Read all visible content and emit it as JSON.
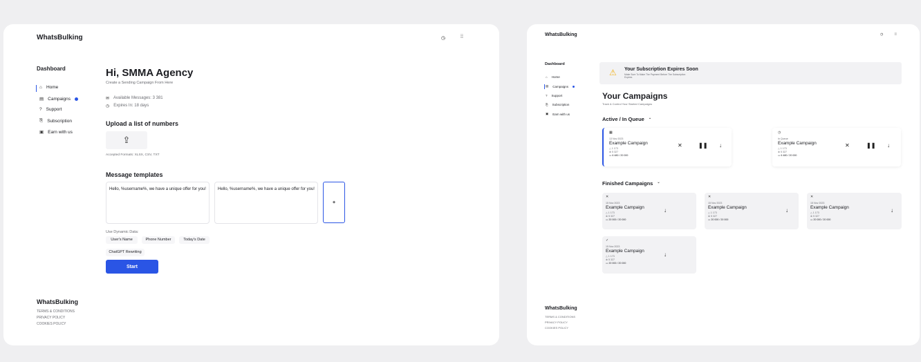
{
  "left_screen": {
    "logo": "WhatsBulking",
    "header_icons": [
      "clock-icon",
      "grid-icon"
    ],
    "sidebar": {
      "title": "Dashboard",
      "items": [
        {
          "label": "Home",
          "icon": "home-icon",
          "active": true
        },
        {
          "label": "Campaigns",
          "icon": "campaign-icon",
          "badge_dot": true
        },
        {
          "label": "Support",
          "icon": "help-icon"
        },
        {
          "label": "Subscription",
          "icon": "subscription-icon"
        },
        {
          "label": "Earn with us",
          "icon": "earn-icon"
        }
      ]
    },
    "greeting": "Hi, SMMA Agency",
    "subtitle": "Create a Sending Campaign From Here",
    "available_messages": "Available Messages: 3 381",
    "expires": "Expires In: 18 days",
    "upload_title": "Upload a list of numbers",
    "accepted_formats": "Accepted Formats: XLSX, CSV, TXT",
    "templates_title": "Message templates",
    "templates": [
      "Hello, %username%, we have a unique offer for you!",
      "Hello, %username%, we have a unique offer for you!"
    ],
    "add_template": "+",
    "dynamic_label": "Use Dynamic Data:",
    "dynamic_chips": [
      "User's Name",
      "Phone Number",
      "Today's Date"
    ],
    "chatgpt_chip": "ChatGPT Rewriting",
    "start_button": "Start",
    "footer": {
      "logo": "WhatsBulking",
      "links": [
        "TERMS & CONDITIONS",
        "PRIVACY POLICY",
        "COOKIES POLICY"
      ]
    }
  },
  "right_screen": {
    "logo": "WhatsBulking",
    "header_icons": [
      "clock-icon",
      "grid-icon"
    ],
    "sidebar": {
      "title": "Dashboard",
      "items": [
        {
          "label": "Home",
          "icon": "home-icon"
        },
        {
          "label": "Campaigns",
          "icon": "campaign-icon",
          "active": true,
          "badge_dot": true
        },
        {
          "label": "Support",
          "icon": "help-icon"
        },
        {
          "label": "Subscription",
          "icon": "subscription-icon"
        },
        {
          "label": "Earn with us",
          "icon": "earn-icon"
        }
      ]
    },
    "banner": {
      "title": "Your Subscription Expires Soon",
      "text": "Make Sure To Make The Payment Before The Subscription Expires",
      "icon": "warning-icon"
    },
    "page_title": "Your Campaigns",
    "page_subtitle": "Track & Control Your Started Campaigns",
    "active_title": "Active / In Queue",
    "active_cards": [
      {
        "status_icon": "calendar-icon",
        "date": "13 Nov 2023",
        "title": "Example Campaign",
        "stat1": "1 173",
        "stat2": "5 327",
        "progress": "6 480 / 20 000",
        "highlight": true
      },
      {
        "status_icon": "clock-icon",
        "date": "In Queue",
        "title": "Example Campaign",
        "stat1": "1 173",
        "stat2": "5 327",
        "progress": "6 480 / 20 000",
        "highlight": false
      }
    ],
    "finished_title": "Finished Campaigns",
    "finished_cards": [
      {
        "status_icon": "close-icon",
        "date": "15 Nov 2023",
        "title": "Example Campaign",
        "stat1": "1 173",
        "stat2": "5 327",
        "progress": "20 000 / 20 000"
      },
      {
        "status_icon": "close-icon",
        "date": "15 Nov 2023",
        "title": "Example Campaign",
        "stat1": "1 173",
        "stat2": "5 327",
        "progress": "20 000 / 20 000"
      },
      {
        "status_icon": "close-icon",
        "date": "15 Nov 2023",
        "title": "Example Campaign",
        "stat1": "1 173",
        "stat2": "5 327",
        "progress": "20 000 / 20 000"
      },
      {
        "status_icon": "check-icon",
        "date": "15 Nov 2023",
        "title": "Example Campaign",
        "stat1": "1 173",
        "stat2": "5 327",
        "progress": "20 000 / 20 000"
      }
    ],
    "footer": {
      "logo": "WhatsBulking",
      "links": [
        "TERMS & CONDITIONS",
        "PRIVACY POLICY",
        "COOKIES POLICY"
      ]
    }
  },
  "colors": {
    "accent": "#2a55e5",
    "background": "#efeff1",
    "card": "#ffffff",
    "finished_card": "#f2f2f4",
    "banner": "#f2f2f4",
    "warning": "#f2b21b"
  }
}
